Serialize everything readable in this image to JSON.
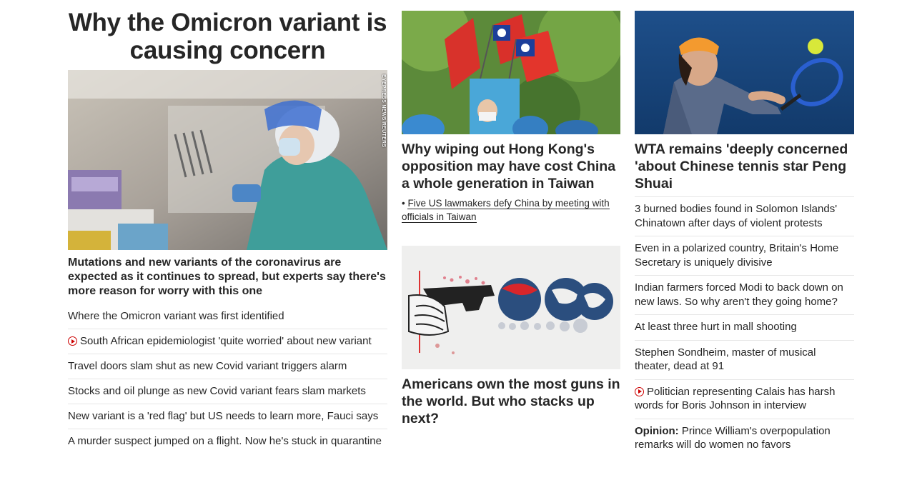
{
  "left": {
    "hero_title": "Why the Omicron variant is causing concern",
    "image_credit": "EYEPRESS NEWS/REUTERS",
    "lead_caption": "Mutations and new variants of the coronavirus are expected as it continues to spread, but experts say there's more reason for worry with this one",
    "links": [
      {
        "text": "Where the Omicron variant was first identified",
        "video": false
      },
      {
        "text": "South African epidemiologist 'quite worried' about new variant",
        "video": true
      },
      {
        "text": "Travel doors slam shut as new Covid variant triggers alarm",
        "video": false
      },
      {
        "text": "Stocks and oil plunge as new Covid variant fears slam markets",
        "video": false
      },
      {
        "text": "New variant is a 'red flag' but US needs to learn more, Fauci says",
        "video": false
      },
      {
        "text": "A murder suspect jumped on a flight. Now he's stuck in quarantine",
        "video": false
      }
    ]
  },
  "middle": {
    "story1_title": "Why wiping out Hong Kong's opposition may have cost China a whole generation in Taiwan",
    "story1_sublink": "Five US lawmakers defy China by meeting with officials in Taiwan",
    "story2_title": "Americans own the most guns in the world. But who stacks up next?"
  },
  "right": {
    "story_title": "WTA remains 'deeply concerned 'about Chinese tennis star Peng Shuai",
    "links": [
      {
        "prefix": "",
        "text": "3 burned bodies found in Solomon Islands' Chinatown after days of violent protests",
        "video": false
      },
      {
        "prefix": "",
        "text": "Even in a polarized country, Britain's Home Secretary is uniquely divisive",
        "video": false
      },
      {
        "prefix": "",
        "text": "Indian farmers forced Modi to back down on new laws. So why aren't they going home?",
        "video": false
      },
      {
        "prefix": "",
        "text": "At least three hurt in mall shooting",
        "video": false
      },
      {
        "prefix": "",
        "text": "Stephen Sondheim, master of musical theater, dead at 91",
        "video": false
      },
      {
        "prefix": "",
        "text": "Politician representing Calais has harsh words for Boris Johnson in interview",
        "video": true
      },
      {
        "prefix": "Opinion:",
        "text": " Prince William's overpopulation remarks will do women no favors",
        "video": false
      }
    ]
  },
  "colors": {
    "text": "#262626",
    "video_icon": "#cc0000",
    "divider": "#e6e6e6"
  }
}
